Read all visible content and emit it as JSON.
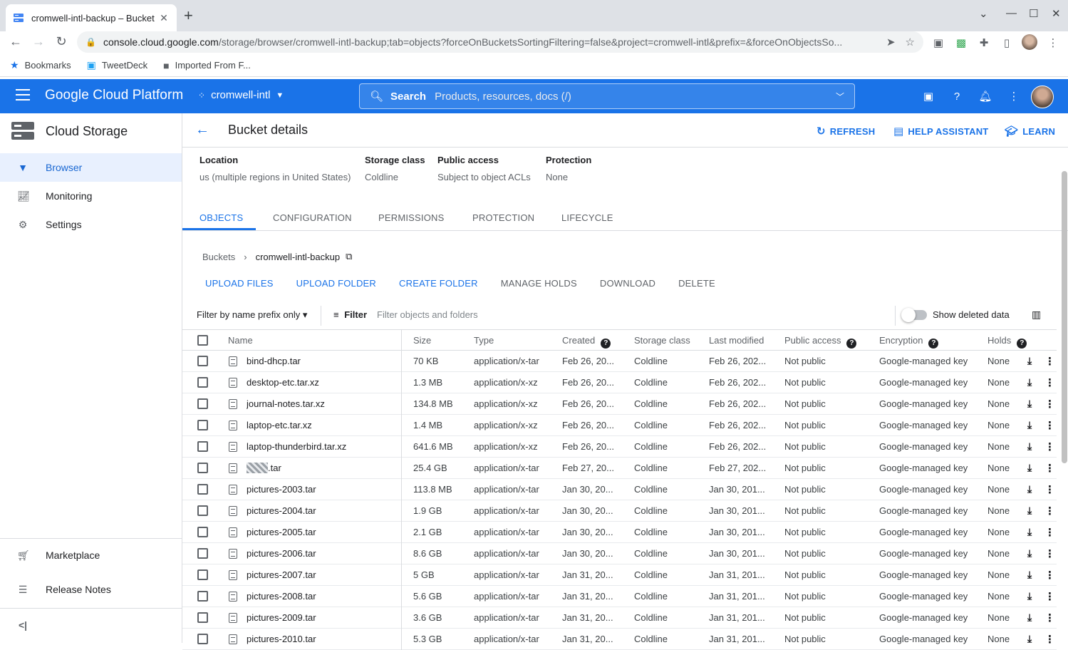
{
  "browser": {
    "tab_title": "cromwell-intl-backup – Bucket",
    "new_tab": "+",
    "url_host": "console.cloud.google.com",
    "url_path": "/storage/browser/cromwell-intl-backup;tab=objects?forceOnBucketsSortingFiltering=false&project=cromwell-intl&prefix=&forceOnObjectsSo...",
    "bookmarks": [
      {
        "label": "Bookmarks",
        "icon": "star-icon"
      },
      {
        "label": "TweetDeck",
        "icon": "tweetdeck-icon"
      },
      {
        "label": "Imported From F...",
        "icon": "folder-icon"
      }
    ]
  },
  "gcp": {
    "brand": "Google Cloud Platform",
    "project": "cromwell-intl",
    "search_label": "Search",
    "search_placeholder": "Products, resources, docs (/)"
  },
  "sidebar": {
    "title": "Cloud Storage",
    "items": [
      {
        "label": "Browser",
        "icon": "bucket-icon",
        "active": true
      },
      {
        "label": "Monitoring",
        "icon": "chart-icon",
        "active": false
      },
      {
        "label": "Settings",
        "icon": "gear-icon",
        "active": false
      }
    ],
    "bottom_items": [
      {
        "label": "Marketplace",
        "icon": "cart-icon"
      },
      {
        "label": "Release Notes",
        "icon": "notes-icon"
      }
    ],
    "collapse": "<|"
  },
  "page": {
    "title": "Bucket details",
    "actions": {
      "refresh": "REFRESH",
      "help": "HELP ASSISTANT",
      "learn": "LEARN"
    },
    "meta": [
      {
        "key": "Location",
        "value": "us (multiple regions in United States)"
      },
      {
        "key": "Storage class",
        "value": "Coldline"
      },
      {
        "key": "Public access",
        "value": "Subject to object ACLs"
      },
      {
        "key": "Protection",
        "value": "None"
      }
    ],
    "tabs": [
      "OBJECTS",
      "CONFIGURATION",
      "PERMISSIONS",
      "PROTECTION",
      "LIFECYCLE"
    ],
    "breadcrumb": {
      "root": "Buckets",
      "bucket": "cromwell-intl-backup"
    },
    "toolbar": [
      "UPLOAD FILES",
      "UPLOAD FOLDER",
      "CREATE FOLDER",
      "MANAGE HOLDS",
      "DOWNLOAD",
      "DELETE"
    ],
    "filter": {
      "prefix_label": "Filter by name prefix only",
      "filter_label": "Filter",
      "placeholder": "Filter objects and folders",
      "deleted_label": "Show deleted data"
    }
  },
  "table": {
    "columns": [
      "Name",
      "Size",
      "Type",
      "Created",
      "Storage class",
      "Last modified",
      "Public access",
      "Encryption",
      "Holds"
    ],
    "rows": [
      [
        "bind-dhcp.tar",
        "70 KB",
        "application/x-tar",
        "Feb 26, 20...",
        "Coldline",
        "Feb 26, 202...",
        "Not public",
        "Google-managed key",
        "None"
      ],
      [
        "desktop-etc.tar.xz",
        "1.3 MB",
        "application/x-xz",
        "Feb 26, 20...",
        "Coldline",
        "Feb 26, 202...",
        "Not public",
        "Google-managed key",
        "None"
      ],
      [
        "journal-notes.tar.xz",
        "134.8 MB",
        "application/x-xz",
        "Feb 26, 20...",
        "Coldline",
        "Feb 26, 202...",
        "Not public",
        "Google-managed key",
        "None"
      ],
      [
        "laptop-etc.tar.xz",
        "1.4 MB",
        "application/x-xz",
        "Feb 26, 20...",
        "Coldline",
        "Feb 26, 202...",
        "Not public",
        "Google-managed key",
        "None"
      ],
      [
        "laptop-thunderbird.tar.xz",
        "641.6 MB",
        "application/x-xz",
        "Feb 26, 20...",
        "Coldline",
        "Feb 26, 202...",
        "Not public",
        "Google-managed key",
        "None"
      ],
      [
        ".tar",
        "25.4 GB",
        "application/x-tar",
        "Feb 27, 20...",
        "Coldline",
        "Feb 27, 202...",
        "Not public",
        "Google-managed key",
        "None"
      ],
      [
        "pictures-2003.tar",
        "113.8 MB",
        "application/x-tar",
        "Jan 30, 20...",
        "Coldline",
        "Jan 30, 201...",
        "Not public",
        "Google-managed key",
        "None"
      ],
      [
        "pictures-2004.tar",
        "1.9 GB",
        "application/x-tar",
        "Jan 30, 20...",
        "Coldline",
        "Jan 30, 201...",
        "Not public",
        "Google-managed key",
        "None"
      ],
      [
        "pictures-2005.tar",
        "2.1 GB",
        "application/x-tar",
        "Jan 30, 20...",
        "Coldline",
        "Jan 30, 201...",
        "Not public",
        "Google-managed key",
        "None"
      ],
      [
        "pictures-2006.tar",
        "8.6 GB",
        "application/x-tar",
        "Jan 30, 20...",
        "Coldline",
        "Jan 30, 201...",
        "Not public",
        "Google-managed key",
        "None"
      ],
      [
        "pictures-2007.tar",
        "5 GB",
        "application/x-tar",
        "Jan 31, 20...",
        "Coldline",
        "Jan 31, 201...",
        "Not public",
        "Google-managed key",
        "None"
      ],
      [
        "pictures-2008.tar",
        "5.6 GB",
        "application/x-tar",
        "Jan 31, 20...",
        "Coldline",
        "Jan 31, 201...",
        "Not public",
        "Google-managed key",
        "None"
      ],
      [
        "pictures-2009.tar",
        "3.6 GB",
        "application/x-tar",
        "Jan 31, 20...",
        "Coldline",
        "Jan 31, 201...",
        "Not public",
        "Google-managed key",
        "None"
      ],
      [
        "pictures-2010.tar",
        "5.3 GB",
        "application/x-tar",
        "Jan 31, 20...",
        "Coldline",
        "Jan 31, 201...",
        "Not public",
        "Google-managed key",
        "None"
      ]
    ]
  },
  "colors": {
    "accent": "#1a73e8",
    "header": "#1a73e8",
    "active_bg": "#e8f0fe"
  }
}
